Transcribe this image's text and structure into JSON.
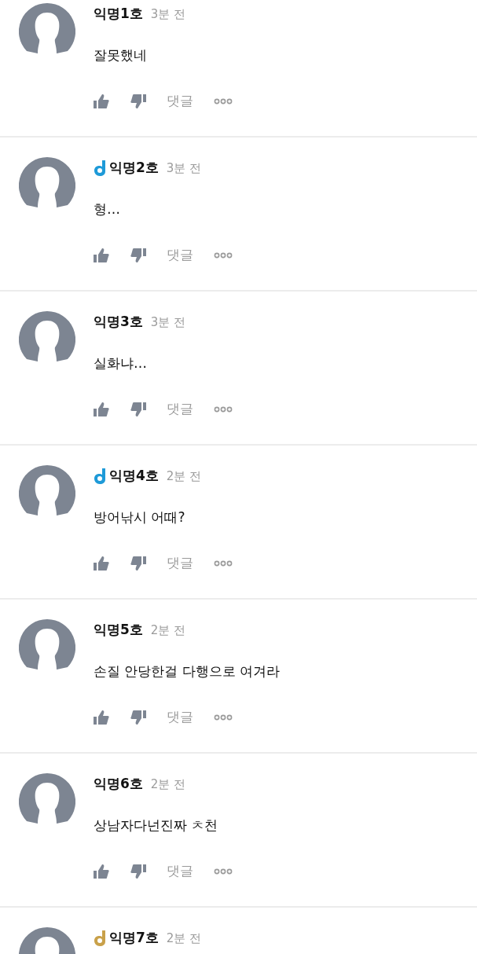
{
  "comments": [
    {
      "author": "익명1호",
      "time": "3분 전",
      "text": "잘못했네",
      "reply_label": "댓글"
    },
    {
      "author": "익명2호",
      "badge": {
        "color": "#1e9ad8"
      },
      "time": "3분 전",
      "text": "형…",
      "reply_label": "댓글"
    },
    {
      "author": "익명3호",
      "time": "3분 전",
      "text": "실화냐…",
      "reply_label": "댓글"
    },
    {
      "author": "익명4호",
      "badge": {
        "color": "#1e9ad8"
      },
      "time": "2분 전",
      "text": "방어낚시 어때?",
      "reply_label": "댓글"
    },
    {
      "author": "익명5호",
      "time": "2분 전",
      "text": "손질 안당한걸 다행으로 여겨라",
      "reply_label": "댓글"
    },
    {
      "author": "익명6호",
      "time": "2분 전",
      "text": "상남자다넌진짜 ㅊ천",
      "reply_label": "댓글"
    },
    {
      "author": "익명7호",
      "badge": {
        "color": "#c9a14a"
      },
      "time": "2분 전"
    }
  ]
}
